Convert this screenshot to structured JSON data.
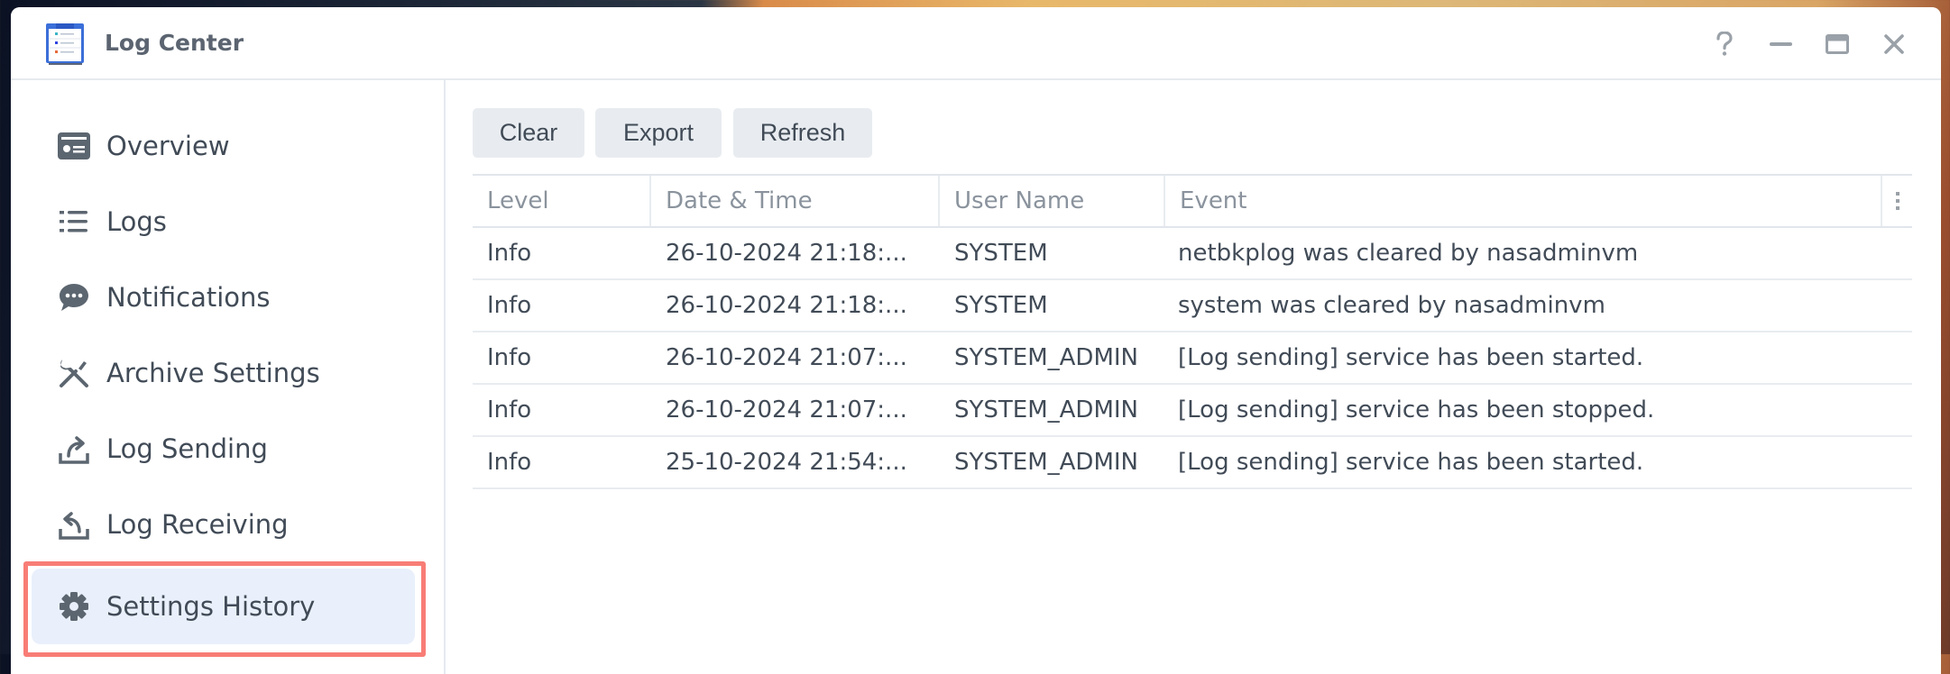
{
  "window": {
    "title": "Log Center",
    "controls": {
      "help": "help-icon",
      "minimize": "minimize-icon",
      "maximize": "maximize-icon",
      "close": "close-icon"
    }
  },
  "sidebar": {
    "items": [
      {
        "label": "Overview",
        "icon": "overview-card-icon",
        "selected": false
      },
      {
        "label": "Logs",
        "icon": "list-icon",
        "selected": false
      },
      {
        "label": "Notifications",
        "icon": "chat-bubble-icon",
        "selected": false
      },
      {
        "label": "Archive Settings",
        "icon": "tools-icon",
        "selected": false
      },
      {
        "label": "Log Sending",
        "icon": "send-tray-icon",
        "selected": false
      },
      {
        "label": "Log Receiving",
        "icon": "receive-tray-icon",
        "selected": false
      },
      {
        "label": "Settings History",
        "icon": "gear-icon",
        "selected": true
      }
    ],
    "highlight_color": "#f87d76",
    "selected_bg": "#e9f0fb"
  },
  "toolbar": {
    "clear_label": "Clear",
    "export_label": "Export",
    "refresh_label": "Refresh"
  },
  "table": {
    "columns": [
      "Level",
      "Date & Time",
      "User Name",
      "Event"
    ],
    "column_menu_icon": "kebab-menu-icon",
    "rows": [
      {
        "level": "Info",
        "datetime": "26-10-2024 21:18:...",
        "user": "SYSTEM",
        "event": "netbkplog was cleared by nasadminvm"
      },
      {
        "level": "Info",
        "datetime": "26-10-2024 21:18:...",
        "user": "SYSTEM",
        "event": "system was cleared by nasadminvm"
      },
      {
        "level": "Info",
        "datetime": "26-10-2024 21:07:...",
        "user": "SYSTEM_ADMIN",
        "event": "[Log sending] service has been started."
      },
      {
        "level": "Info",
        "datetime": "26-10-2024 21:07:...",
        "user": "SYSTEM_ADMIN",
        "event": "[Log sending] service has been stopped."
      },
      {
        "level": "Info",
        "datetime": "25-10-2024 21:54:...",
        "user": "SYSTEM_ADMIN",
        "event": "[Log sending] service has been started."
      }
    ]
  }
}
